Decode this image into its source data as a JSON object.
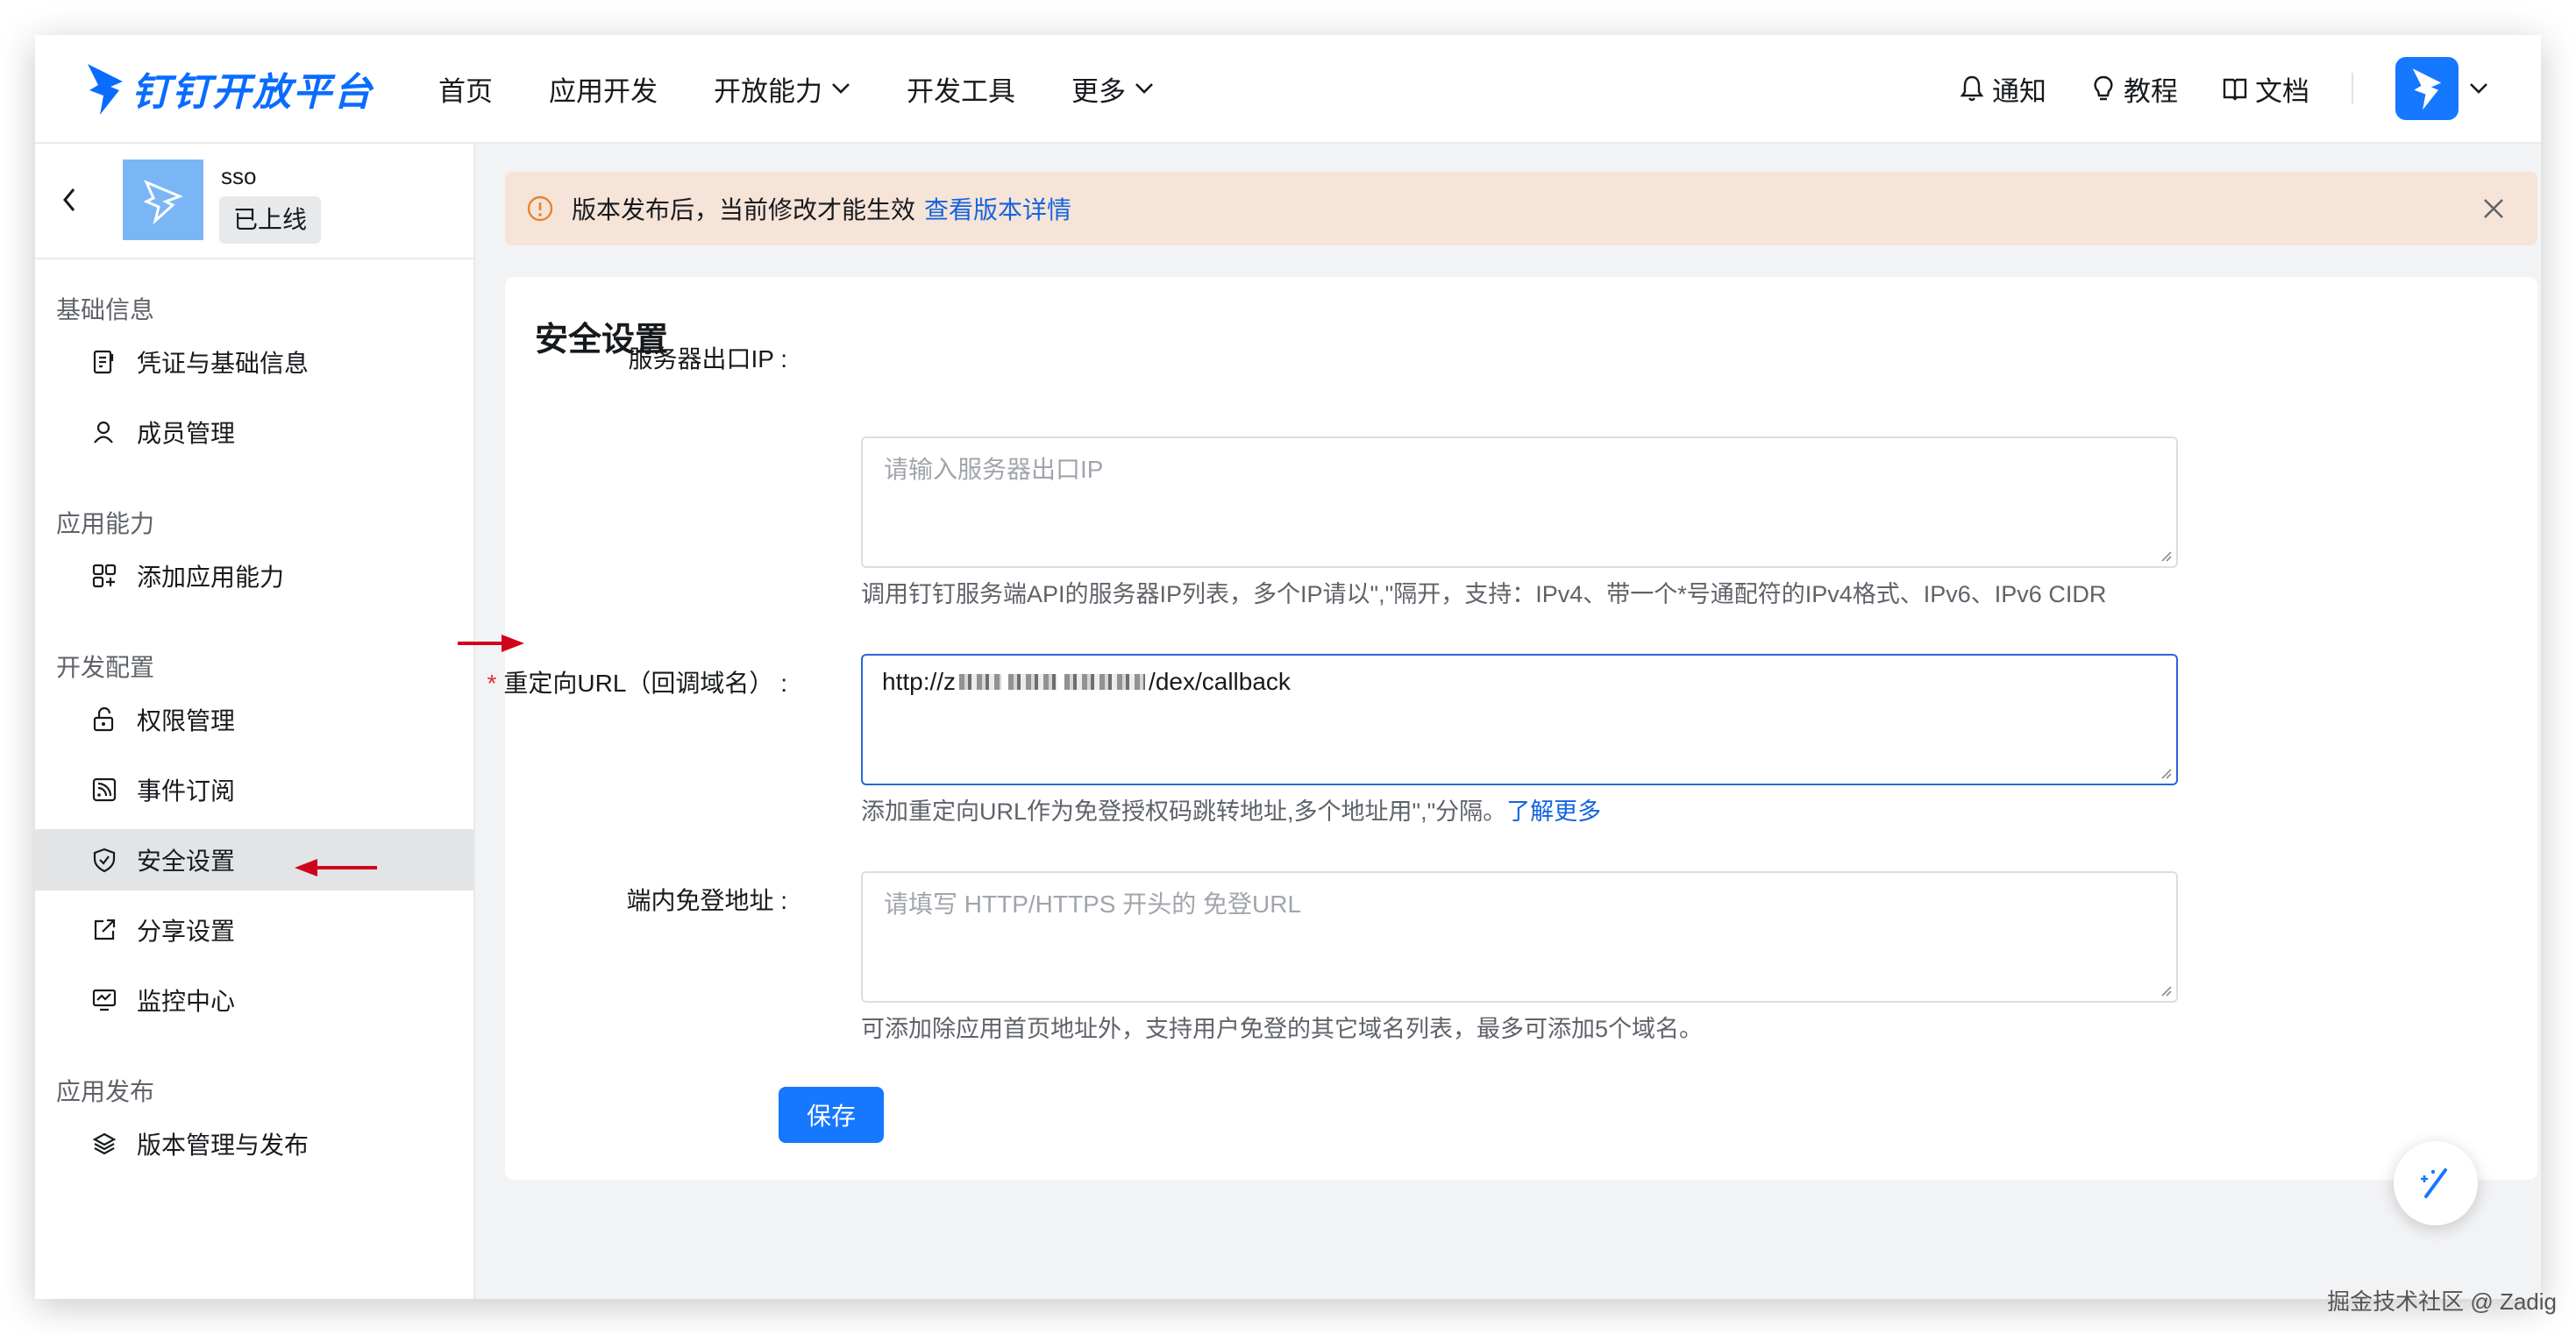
{
  "brand": {
    "name": "钉钉开放平台",
    "color": "#0a6cff"
  },
  "nav": {
    "items": [
      {
        "label": "首页",
        "dropdown": false
      },
      {
        "label": "应用开发",
        "dropdown": false
      },
      {
        "label": "开放能力",
        "dropdown": true
      },
      {
        "label": "开发工具",
        "dropdown": false
      },
      {
        "label": "更多",
        "dropdown": true
      }
    ],
    "right": [
      {
        "label": "通知",
        "icon": "bell-icon"
      },
      {
        "label": "教程",
        "icon": "lightbulb-icon"
      },
      {
        "label": "文档",
        "icon": "book-icon"
      }
    ]
  },
  "app": {
    "name": "sso",
    "status": "已上线"
  },
  "sidebar": {
    "sections": [
      {
        "title": "基础信息",
        "items": [
          {
            "label": "凭证与基础信息",
            "icon": "credential-icon"
          },
          {
            "label": "成员管理",
            "icon": "user-icon"
          }
        ]
      },
      {
        "title": "应用能力",
        "items": [
          {
            "label": "添加应用能力",
            "icon": "grid-plus-icon"
          }
        ]
      },
      {
        "title": "开发配置",
        "items": [
          {
            "label": "权限管理",
            "icon": "lock-icon"
          },
          {
            "label": "事件订阅",
            "icon": "rss-icon"
          },
          {
            "label": "安全设置",
            "icon": "shield-icon",
            "active": true
          },
          {
            "label": "分享设置",
            "icon": "share-icon"
          },
          {
            "label": "监控中心",
            "icon": "monitor-icon"
          }
        ]
      },
      {
        "title": "应用发布",
        "items": [
          {
            "label": "版本管理与发布",
            "icon": "layers-icon"
          }
        ]
      }
    ]
  },
  "notice": {
    "text": "版本发布后，当前修改才能生效",
    "link": "查看版本详情",
    "bg_color": "#f6e4d8"
  },
  "security": {
    "title": "安全设置",
    "server_ip": {
      "label": "服务器出口IP :",
      "placeholder": "请输入服务器出口IP",
      "help": "调用钉钉服务端API的服务器IP列表，多个IP请以\",\"隔开，支持：IPv4、带一个*号通配符的IPv4格式、IPv6、IPv6 CIDR"
    },
    "redirect_url": {
      "required_mark": "*",
      "label": "重定向URL（回调域名） :",
      "value_prefix": "http://z",
      "value_suffix": "/dex/callback",
      "help": "添加重定向URL作为免登授权码跳转地址,多个地址用\",\"分隔。",
      "help_link": "了解更多"
    },
    "inapp_login": {
      "label": "端内免登地址 :",
      "placeholder": "请填写 HTTP/HTTPS 开头的 免登URL",
      "help": "可添加除应用首页地址外，支持用户免登的其它域名列表，最多可添加5个域名。"
    },
    "save_label": "保存"
  },
  "watermark": "掘金技术社区 @ Zadig",
  "colors": {
    "accent": "#1677ff",
    "link": "#1464dd",
    "annotation_arrow": "#d0021b"
  }
}
